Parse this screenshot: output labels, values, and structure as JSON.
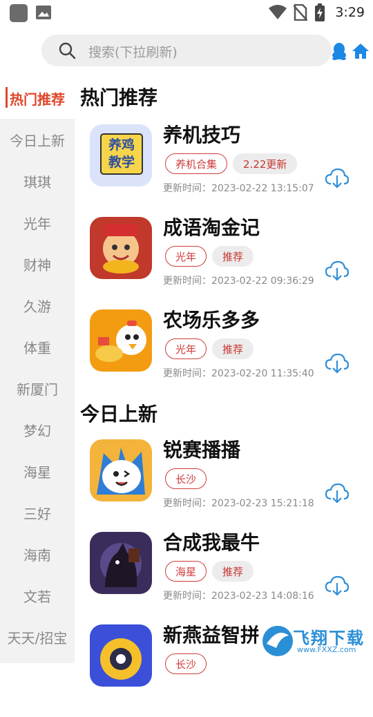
{
  "status_bar": {
    "time": "3:29",
    "icons": [
      "app-square-icon",
      "gallery-icon",
      "wifi-icon",
      "no-sim-icon",
      "battery-charging-icon"
    ]
  },
  "search": {
    "placeholder": "搜索(下拉刷新)",
    "icons": [
      "search-icon",
      "qq-icon",
      "home-icon"
    ]
  },
  "sidebar": {
    "active_index": 0,
    "items": [
      {
        "label": "热门推荐"
      },
      {
        "label": "今日上新"
      },
      {
        "label": "琪琪"
      },
      {
        "label": "光年"
      },
      {
        "label": "财神"
      },
      {
        "label": "久游"
      },
      {
        "label": "体重"
      },
      {
        "label": "新厦门"
      },
      {
        "label": "梦幻"
      },
      {
        "label": "海星"
      },
      {
        "label": "三好"
      },
      {
        "label": "海南"
      },
      {
        "label": "文若"
      },
      {
        "label": "天天/招宝"
      }
    ]
  },
  "sections": [
    {
      "title": "热门推荐",
      "apps": [
        {
          "name": "养机技巧",
          "icon_text": "养鸡\n教学",
          "tags": [
            {
              "text": "养机合集",
              "style": "outline"
            },
            {
              "text": "2.22更新",
              "style": "fill"
            }
          ],
          "update_time": "更新时间：2023-02-22 13:15:07"
        },
        {
          "name": "成语淘金记",
          "tags": [
            {
              "text": "光年",
              "style": "outline"
            },
            {
              "text": "推荐",
              "style": "fill"
            }
          ],
          "update_time": "更新时间：2023-02-22 09:36:29"
        },
        {
          "name": "农场乐多多",
          "tags": [
            {
              "text": "光年",
              "style": "outline"
            },
            {
              "text": "推荐",
              "style": "fill"
            }
          ],
          "update_time": "更新时间：2023-02-20 11:35:40"
        }
      ]
    },
    {
      "title": "今日上新",
      "apps": [
        {
          "name": "锐赛播播",
          "tags": [
            {
              "text": "长沙",
              "style": "outline"
            }
          ],
          "update_time": "更新时间：2023-02-23 15:21:18"
        },
        {
          "name": "合成我最牛",
          "tags": [
            {
              "text": "海星",
              "style": "outline"
            },
            {
              "text": "推荐",
              "style": "fill"
            }
          ],
          "update_time": "更新时间：2023-02-23 14:08:16"
        },
        {
          "name": "新燕益智拼",
          "tags": [
            {
              "text": "长沙",
              "style": "outline"
            }
          ],
          "update_time": ""
        }
      ]
    }
  ],
  "watermark": {
    "text": "飞翔下载",
    "url_text": "www.FXXZ.com"
  },
  "colors": {
    "accent": "#e0452a",
    "tag_red": "#cf3b3b",
    "download_blue": "#2f8fd8",
    "sidebar_bg": "#f2f2f2"
  }
}
